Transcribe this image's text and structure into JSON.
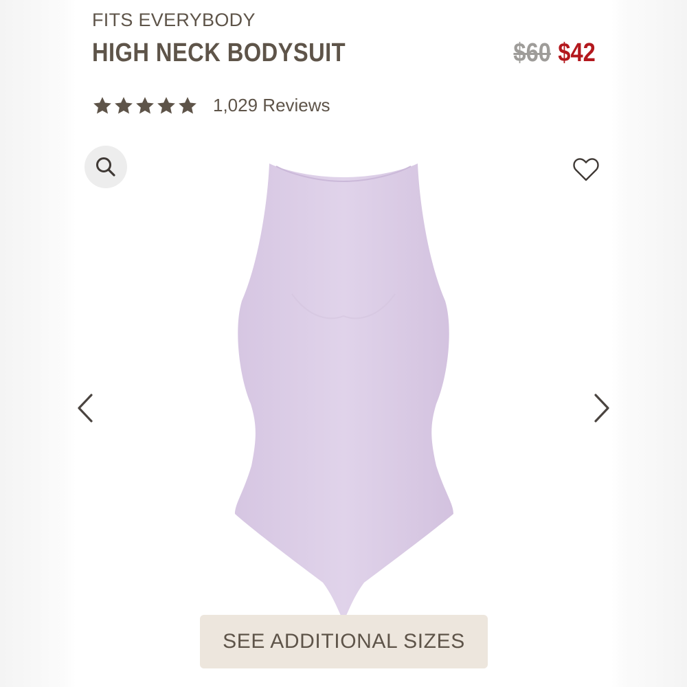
{
  "product": {
    "collection": "FITS EVERYBODY",
    "title": "HIGH NECK BODYSUIT",
    "price_original": "$60",
    "price_sale": "$42",
    "rating_stars": 5,
    "reviews_label": "1,029 Reviews",
    "image_alt": "lavender high neck bodysuit",
    "garment_color": "#dccde6"
  },
  "actions": {
    "zoom_icon": "search-icon",
    "favorite_icon": "heart-icon",
    "prev_icon": "chevron-left-icon",
    "next_icon": "chevron-right-icon",
    "sizes_button": "SEE ADDITIONAL SIZES"
  },
  "colors": {
    "text": "#5e5449",
    "sale": "#b3181d",
    "strikethrough": "#9e9c99",
    "button_bg": "#ede6dd",
    "zoom_bg": "#ededed"
  }
}
